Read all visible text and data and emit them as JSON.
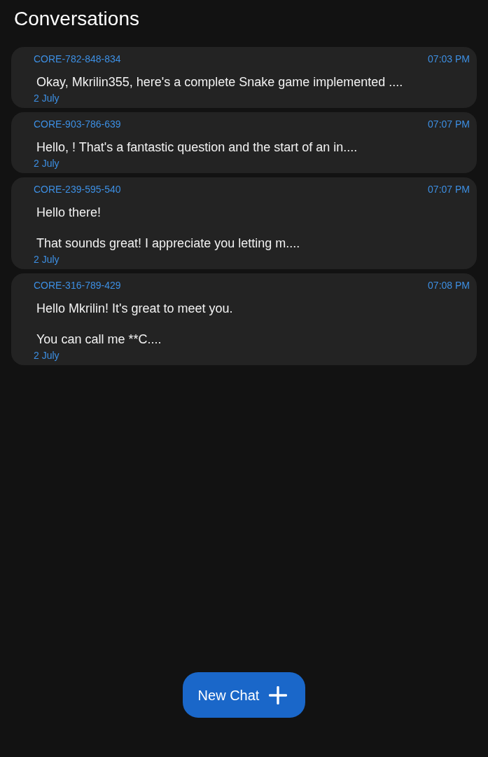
{
  "header": {
    "title": "Conversations"
  },
  "conversations": [
    {
      "code": "CORE-782-848-834",
      "time": "07:03 PM",
      "message": [
        "Okay, Mkrilin355, here's a complete Snake game implemented ...."
      ],
      "date": "2 July"
    },
    {
      "code": "CORE-903-786-639",
      "time": "07:07 PM",
      "message": [
        "Hello, ! That's a fantastic question and the start of an in...."
      ],
      "date": "2 July"
    },
    {
      "code": "CORE-239-595-540",
      "time": "07:07 PM",
      "message": [
        "Hello there!",
        "That sounds great! I appreciate you letting m...."
      ],
      "date": "2 July"
    },
    {
      "code": "CORE-316-789-429",
      "time": "07:08 PM",
      "message": [
        "Hello Mkrilin! It's great to meet you.",
        "You can call me **C...."
      ],
      "date": "2 July"
    }
  ],
  "new_chat_button": {
    "label": "New Chat"
  }
}
